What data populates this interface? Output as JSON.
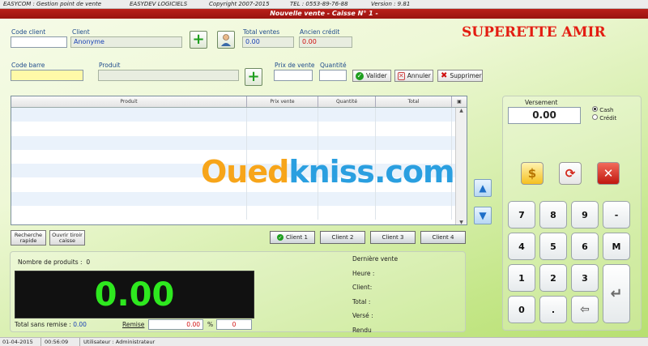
{
  "titlebar": {
    "app": "EASYCOM : Gestion point de vente",
    "company": "EASYDEV LOGICIELS",
    "copyright": "Copyright 2007-2015",
    "tel": "TEL : 0553-89-76-88",
    "version": "Version : 9.81"
  },
  "window_title": "Nouvelle vente - Caisse N° 1 -",
  "brand": "SUPERETTE AMIR",
  "form": {
    "code_client_label": "Code client",
    "code_client_value": "",
    "client_label": "Client",
    "client_value": "Anonyme",
    "total_ventes_label": "Total ventes",
    "total_ventes_value": "0.00",
    "ancien_credit_label": "Ancien crédit",
    "ancien_credit_value": "0.00",
    "code_barre_label": "Code barre",
    "code_barre_value": "",
    "produit_label": "Produit",
    "produit_value": "",
    "prix_vente_label": "Prix de vente",
    "prix_vente_value": "",
    "quantite_label": "Quantité",
    "quantite_value": "",
    "valider_label": "Valider",
    "annuler_label": "Annuler",
    "supprimer_label": "Supprimer"
  },
  "table": {
    "columns": [
      "Produit",
      "Prix vente",
      "Quantité",
      "Total"
    ],
    "rows": []
  },
  "watermark": {
    "part1": "Oued",
    "part2": "kniss",
    "part3": ".com"
  },
  "buttons": {
    "recherche_line1": "Recherche",
    "recherche_line2": "rapide",
    "tiroir_line1": "Ouvrir tiroir",
    "tiroir_line2": "caisse",
    "clients": [
      "Client 1",
      "Client 2",
      "Client 3",
      "Client 4"
    ]
  },
  "totals": {
    "nombre_label": "Nombre de produits :",
    "nombre_value": "0",
    "display_value": "0.00",
    "total_sans_remise_label": "Total sans remise :",
    "total_sans_remise_value": "0.00",
    "remise_label": "Remise",
    "remise_value": "0.00",
    "pct_label": "%",
    "pct_value": "0"
  },
  "derniere_vente": {
    "title": "Dernière vente",
    "heure": "Heure :",
    "client": "Client:",
    "total": "Total :",
    "verse": "Versé :",
    "rendu": "Rendu"
  },
  "versement": {
    "label": "Versement",
    "value": "0.00",
    "cash": "Cash",
    "credit": "Crédit"
  },
  "keypad": [
    "7",
    "8",
    "9",
    "-",
    "4",
    "5",
    "6",
    "M",
    "1",
    "2",
    "3",
    "0",
    "."
  ],
  "statusbar": {
    "date": "01-04-2015",
    "time": "00:56:09",
    "user": "Utilisateur : Administrateur"
  },
  "icons": {
    "dollar": "dollar-icon",
    "refresh": "refresh-icon",
    "close": "close-icon",
    "backspace": "backspace-icon",
    "enter": "enter-icon"
  }
}
